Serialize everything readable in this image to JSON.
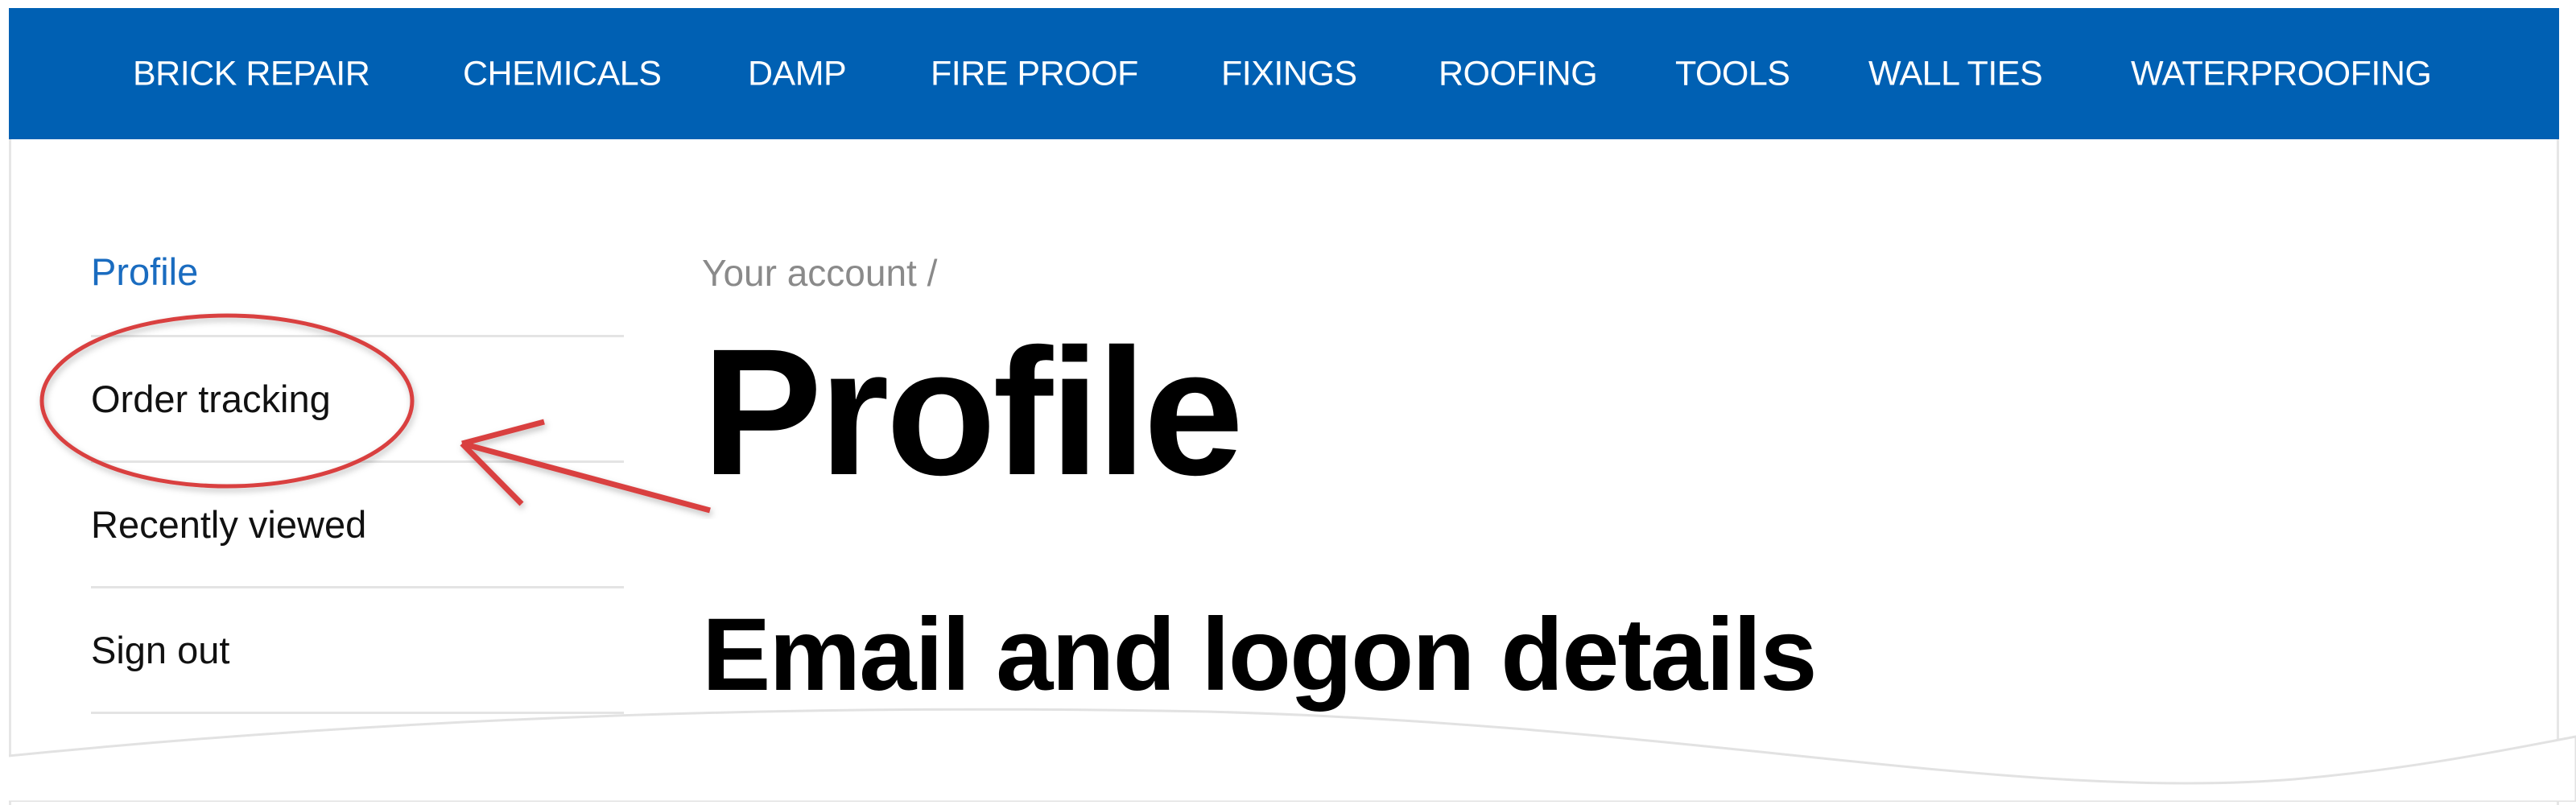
{
  "nav": {
    "items": [
      {
        "label": "BRICK REPAIR"
      },
      {
        "label": "CHEMICALS"
      },
      {
        "label": "DAMP"
      },
      {
        "label": "FIRE PROOF"
      },
      {
        "label": "FIXINGS"
      },
      {
        "label": "ROOFING"
      },
      {
        "label": "TOOLS"
      },
      {
        "label": "WALL TIES"
      },
      {
        "label": "WATERPROOFING"
      }
    ],
    "background": "#0060b3"
  },
  "sidebar": {
    "items": [
      {
        "label": "Profile",
        "active": true
      },
      {
        "label": "Order tracking",
        "active": false
      },
      {
        "label": "Recently viewed",
        "active": false
      },
      {
        "label": "Sign out",
        "active": false
      }
    ]
  },
  "breadcrumb": {
    "text": "Your account /"
  },
  "main": {
    "title": "Profile",
    "section_heading": "Email and logon details"
  },
  "annotation": {
    "color": "#d9403f",
    "target": "Order tracking"
  }
}
